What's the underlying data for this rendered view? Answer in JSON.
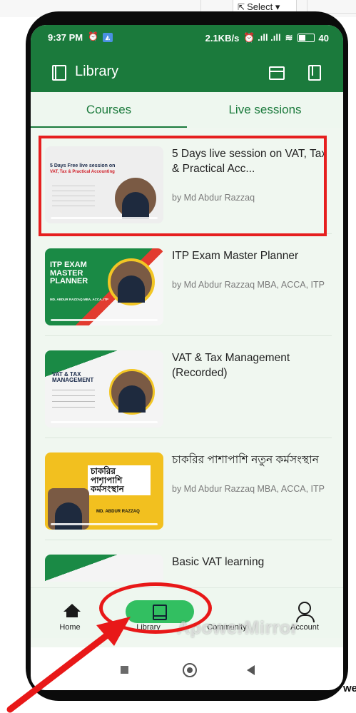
{
  "browser": {
    "select_label": "Select"
  },
  "status_bar": {
    "time": "9:37 PM",
    "speed": "2.1KB/s",
    "battery": "40"
  },
  "appbar": {
    "title": "Library"
  },
  "tabs": [
    {
      "label": "Courses"
    },
    {
      "label": "Live sessions"
    }
  ],
  "courses": [
    {
      "title": "5 Days live session on VAT, Tax & Practical Acc...",
      "author": "by Md Abdur Razzaq",
      "thumb": {
        "headline": "5 Days Free live session on",
        "sub": "VAT, Tax & Practical Accounting",
        "highlight": "Free"
      }
    },
    {
      "title": "ITP Exam Master Planner",
      "author": "by Md Abdur Razzaq MBA, ACCA, ITP",
      "thumb": {
        "headline": "ITP EXAM MASTER PLANNER",
        "sub": "MD. ABDUR RAZZAQ MBA, ACCA, ITP"
      }
    },
    {
      "title": "VAT & Tax Management (Recorded)",
      "author": "",
      "thumb": {
        "headline": "VAT & TAX MANAGEMENT",
        "sub": ""
      }
    },
    {
      "title": "চাকরির পাশাপাশি নতুন কর্মসংস্থান",
      "author": "by Md Abdur Razzaq MBA, ACCA, ITP",
      "thumb": {
        "headline": "চাকরির পাশাপাশি কর্মসংস্থান",
        "sub": "MD. ABDUR RAZZAQ"
      }
    },
    {
      "title": "Basic VAT learning",
      "author": "",
      "thumb": {
        "headline": "",
        "sub": ""
      }
    }
  ],
  "bottom_nav": [
    {
      "label": "Home",
      "icon": "home-icon"
    },
    {
      "label": "Library",
      "icon": "book-icon",
      "active": true
    },
    {
      "label": "Community",
      "icon": "chat-icon"
    },
    {
      "label": "Account",
      "icon": "person-icon"
    }
  ],
  "watermark": "ApowerMirror",
  "corner_text": "we",
  "colors": {
    "primary": "#1b7a3c",
    "active_pill": "#32bf61",
    "annotation": "#e61f1f"
  }
}
